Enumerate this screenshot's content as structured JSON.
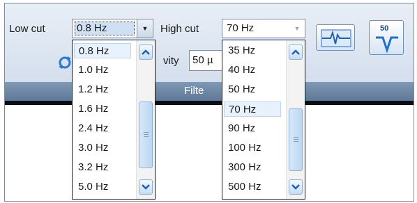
{
  "toolbar": {
    "low_cut_label": "Low cut",
    "low_cut_value": "0.8 Hz",
    "high_cut_label": "High cut",
    "high_cut_value": "70 Hz",
    "sensitivity_label_fragment": "vity",
    "sensitivity_value_fragment": "50 µ",
    "group_title_fragment": "Filte",
    "notch_button_text": "50"
  },
  "low_cut_dropdown": {
    "items": [
      "0.8 Hz",
      "1.0 Hz",
      "1.2 Hz",
      "1.6 Hz",
      "2.4 Hz",
      "3.0 Hz",
      "3.2 Hz",
      "5.0 Hz"
    ],
    "selected": "0.8 Hz"
  },
  "high_cut_dropdown": {
    "items": [
      "35 Hz",
      "40 Hz",
      "50 Hz",
      "70 Hz",
      "90 Hz",
      "100 Hz",
      "300 Hz",
      "500 Hz"
    ],
    "selected": "70 Hz"
  },
  "colors": {
    "ribbon_bg": "#dde6f1",
    "group_footer": "#6f89a8",
    "selection_bg": "#e8f2fd",
    "icon_blue": "#1f6fd0"
  },
  "icons": {
    "refresh": "refresh-icon",
    "combo_arrow": "chevron-down-icon",
    "scroll_up": "chevron-up-icon",
    "scroll_down": "chevron-down-icon",
    "filter_tool": "waveform-filter-icon",
    "notch_tool": "notch-50hz-icon"
  }
}
